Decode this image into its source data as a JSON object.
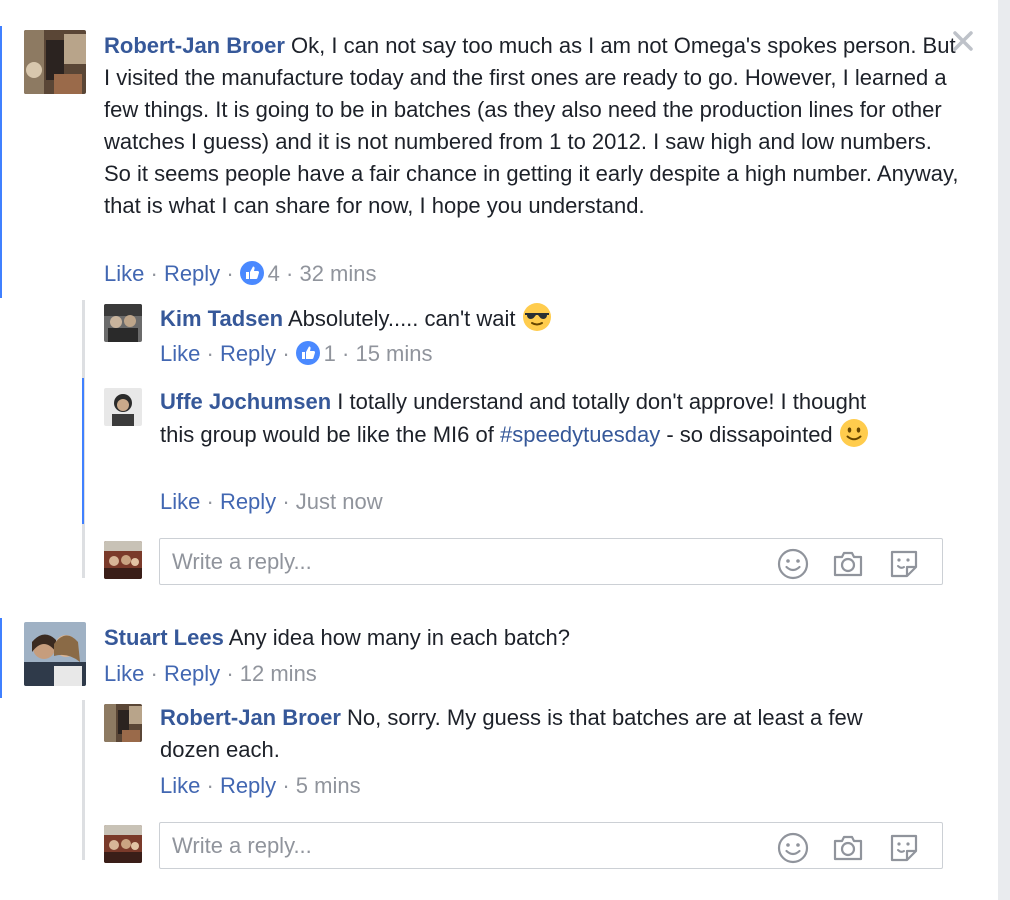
{
  "comments": [
    {
      "author": "Robert-Jan Broer",
      "text": "Ok, I can not say too much as I am not Omega's spokes person. But I visited the manufacture today and the first ones are ready to go. However, I learned a few things. It is going to be in batches (as they also need the production lines for other watches I guess) and it is not numbered from 1 to 2012. I saw high and low numbers. So it seems people have a fair chance in getting it early despite a high number. Anyway, that is what I can share for now, I hope you understand.",
      "like_label": "Like",
      "reply_label": "Reply",
      "like_count": "4",
      "time": "32 mins",
      "replies": [
        {
          "author": "Kim Tadsen",
          "text": "Absolutely..... can't wait",
          "emoji": "sunglasses-emoji",
          "like_label": "Like",
          "reply_label": "Reply",
          "like_count": "1",
          "time": "15 mins"
        },
        {
          "author": "Uffe Jochumsen",
          "text_before": "I totally understand and totally don't approve! I thought this group would be like the MI6 of",
          "hashtag": "#speedytuesday",
          "text_after": "- so dissapointed",
          "emoji": "smile-emoji",
          "like_label": "Like",
          "reply_label": "Reply",
          "time": "Just now"
        }
      ],
      "reply_box": {
        "placeholder": "Write a reply..."
      }
    },
    {
      "author": "Stuart Lees",
      "text": "Any idea how many in each batch?",
      "like_label": "Like",
      "reply_label": "Reply",
      "time": "12 mins",
      "replies": [
        {
          "author": "Robert-Jan Broer",
          "text": "No, sorry. My guess is that batches are at least a few dozen each.",
          "like_label": "Like",
          "reply_label": "Reply",
          "time": "5 mins"
        }
      ],
      "reply_box": {
        "placeholder": "Write a reply..."
      }
    }
  ],
  "separator": "·",
  "icons": [
    "close-icon",
    "like-reaction-icon",
    "emoji-picker-icon",
    "camera-icon",
    "sticker-icon"
  ],
  "colors": {
    "link": "#365899",
    "action_link": "#4267b2",
    "meta": "#90949c",
    "thread_line": "#4080ff",
    "reply_line": "#dddfe2",
    "sidebar": "#e9ebee"
  }
}
